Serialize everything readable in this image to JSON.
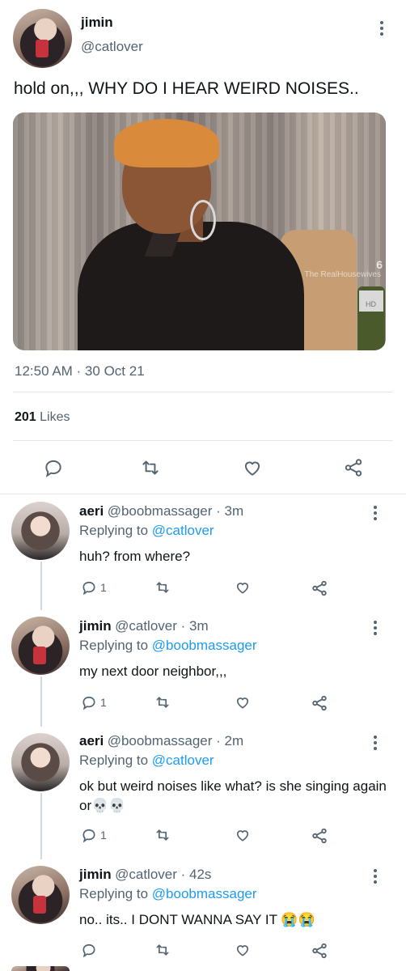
{
  "tweet": {
    "author_name": "jimin",
    "author_handle": "@catlover",
    "text": "hold on,,, WHY DO I HEAR WEIRD NOISES..",
    "timestamp": "12:50 AM · 30 Oct 21",
    "likes_count": "201",
    "likes_label": "Likes",
    "media_watermark_number": "6",
    "media_watermark": "The RealHousewives",
    "media_watermark_2": "HD"
  },
  "replies": [
    {
      "name": "aeri",
      "handle_time": "@boobmassager · 3m",
      "replying_prefix": "Replying to",
      "replying_to": "@catlover",
      "text": "huh? from where?",
      "reply_count": "1"
    },
    {
      "name": "jimin",
      "handle_time": "@catlover · 3m",
      "replying_prefix": "Replying to",
      "replying_to": "@boobmassager",
      "text": "my next door neighbor,,,",
      "reply_count": "1"
    },
    {
      "name": "aeri",
      "handle_time": "@boobmassager · 2m",
      "replying_prefix": "Replying to",
      "replying_to": "@catlover",
      "text": "ok but weird noises like what? is she singing again or💀💀",
      "reply_count": "1"
    },
    {
      "name": "jimin",
      "handle_time": "@catlover · 42s",
      "replying_prefix": "Replying to",
      "replying_to": "@boobmassager",
      "text": "no.. its.. I DONT WANNA SAY IT 😭😭",
      "reply_count": ""
    }
  ],
  "icons": {
    "reply": "reply-icon",
    "retweet": "retweet-icon",
    "like": "heart-icon",
    "share": "share-icon",
    "more": "more-icon"
  },
  "colors": {
    "link": "#1d9bf0",
    "secondary_text": "#536471"
  }
}
